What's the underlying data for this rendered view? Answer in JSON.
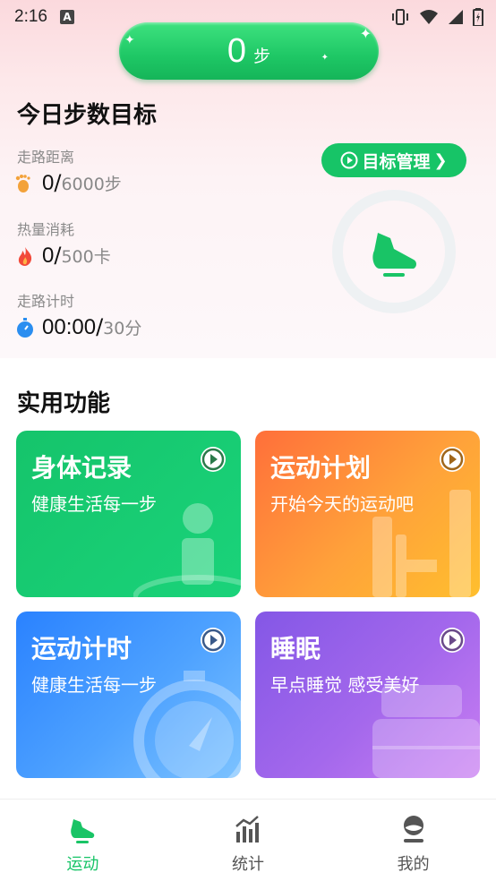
{
  "status_bar": {
    "time": "2:16",
    "notification_icon": "A"
  },
  "steps": {
    "count": "0",
    "unit": "步"
  },
  "goal_section": {
    "title": "今日步数目标",
    "manage_button": "目标管理",
    "metrics": [
      {
        "label": "走路距离",
        "value": "0",
        "goal": "6000步",
        "icon": "footprint-icon"
      },
      {
        "label": "热量消耗",
        "value": "0",
        "goal": "500卡",
        "icon": "flame-icon"
      },
      {
        "label": "走路计时",
        "value": "00:00",
        "goal": "30分",
        "icon": "stopwatch-icon"
      }
    ]
  },
  "tools_section": {
    "title": "实用功能",
    "cards": [
      {
        "title": "身体记录",
        "subtitle": "健康生活每一步",
        "colors": [
          "#1fcf74",
          "#13c36a"
        ]
      },
      {
        "title": "运动计划",
        "subtitle": "开始今天的运动吧",
        "colors": [
          "#ff7a3a",
          "#ffb531"
        ]
      },
      {
        "title": "运动计时",
        "subtitle": "健康生活每一步",
        "colors": [
          "#2f86ff",
          "#6ab8ff"
        ]
      },
      {
        "title": "睡眠",
        "subtitle": "早点睡觉 感受美好",
        "colors": [
          "#8a5de8",
          "#c27af0"
        ]
      }
    ]
  },
  "bottom_nav": [
    {
      "label": "运动",
      "icon": "sneaker-icon",
      "active": true
    },
    {
      "label": "统计",
      "icon": "bar-chart-icon",
      "active": false
    },
    {
      "label": "我的",
      "icon": "profile-icon",
      "active": false
    }
  ],
  "accent_color": "#17c467"
}
